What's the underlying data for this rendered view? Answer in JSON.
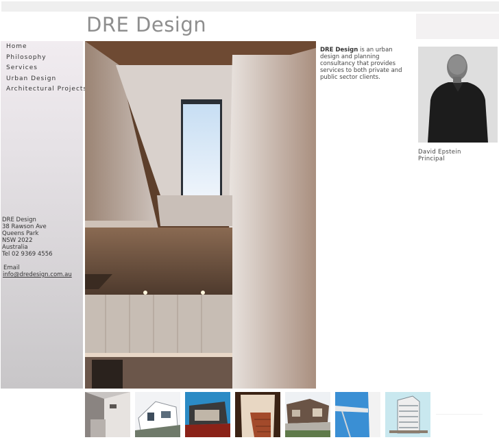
{
  "header": {
    "title": "DRE Design"
  },
  "nav": {
    "items": [
      {
        "label": "Home"
      },
      {
        "label": "Philosophy"
      },
      {
        "label": "Services"
      },
      {
        "label": "Urban Design"
      },
      {
        "label": "Architectural Projects"
      }
    ]
  },
  "contact": {
    "company": "DRE Design",
    "street": "38 Rawson Ave",
    "suburb": "Queens Park",
    "state": "NSW 2022",
    "country": "Australia",
    "tel": "Tel 02 9369 4556",
    "email_label": "Email",
    "email": "info@dredesign.com.au"
  },
  "intro": {
    "brand": "DRE Design",
    "text": " is an urban design and planning consultancy that provides services to both private and public sector clients."
  },
  "principal": {
    "name": "David Epstein",
    "role": "Principal"
  },
  "colors": {
    "title": "#8e8e8e",
    "sidebar_top": "#f1ecf0",
    "sidebar_bottom": "#c8c6c8"
  }
}
